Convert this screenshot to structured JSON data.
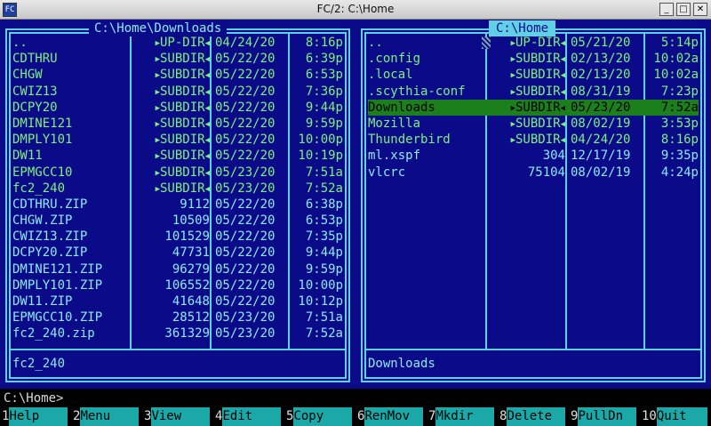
{
  "window": {
    "title": "FC/2: C:\\Home",
    "sys_icon": "FC",
    "buttons": {
      "minimize": "_",
      "maximize": "□",
      "close": "✕"
    }
  },
  "left_panel": {
    "path": "C:\\Home\\Downloads",
    "status": "fc2_240",
    "rows": [
      {
        "name": "..",
        "size": "UP-DIR",
        "date": "04/24/20",
        "time": "8:16p",
        "kind": "dir"
      },
      {
        "name": "CDTHRU",
        "size": "SUBDIR",
        "date": "05/22/20",
        "time": "6:39p",
        "kind": "dir"
      },
      {
        "name": "CHGW",
        "size": "SUBDIR",
        "date": "05/22/20",
        "time": "6:53p",
        "kind": "dir"
      },
      {
        "name": "CWIZ13",
        "size": "SUBDIR",
        "date": "05/22/20",
        "time": "7:36p",
        "kind": "dir"
      },
      {
        "name": "DCPY20",
        "size": "SUBDIR",
        "date": "05/22/20",
        "time": "9:44p",
        "kind": "dir"
      },
      {
        "name": "DMINE121",
        "size": "SUBDIR",
        "date": "05/22/20",
        "time": "9:59p",
        "kind": "dir"
      },
      {
        "name": "DMPLY101",
        "size": "SUBDIR",
        "date": "05/22/20",
        "time": "10:00p",
        "kind": "dir"
      },
      {
        "name": "DW11",
        "size": "SUBDIR",
        "date": "05/22/20",
        "time": "10:19p",
        "kind": "dir"
      },
      {
        "name": "EPMGCC10",
        "size": "SUBDIR",
        "date": "05/23/20",
        "time": "7:51a",
        "kind": "dir"
      },
      {
        "name": "fc2_240",
        "size": "SUBDIR",
        "date": "05/23/20",
        "time": "7:52a",
        "kind": "dir"
      },
      {
        "name": "CDTHRU.ZIP",
        "size": "9112",
        "date": "05/22/20",
        "time": "6:38p",
        "kind": "file"
      },
      {
        "name": "CHGW.ZIP",
        "size": "10509",
        "date": "05/22/20",
        "time": "6:53p",
        "kind": "file"
      },
      {
        "name": "CWIZ13.ZIP",
        "size": "101529",
        "date": "05/22/20",
        "time": "7:35p",
        "kind": "file"
      },
      {
        "name": "DCPY20.ZIP",
        "size": "47731",
        "date": "05/22/20",
        "time": "9:44p",
        "kind": "file"
      },
      {
        "name": "DMINE121.ZIP",
        "size": "96279",
        "date": "05/22/20",
        "time": "9:59p",
        "kind": "file"
      },
      {
        "name": "DMPLY101.ZIP",
        "size": "106552",
        "date": "05/22/20",
        "time": "10:00p",
        "kind": "file"
      },
      {
        "name": "DW11.ZIP",
        "size": "41648",
        "date": "05/22/20",
        "time": "10:12p",
        "kind": "file"
      },
      {
        "name": "EPMGCC10.ZIP",
        "size": "28512",
        "date": "05/23/20",
        "time": "7:51a",
        "kind": "file"
      },
      {
        "name": "fc2_240.zip",
        "size": "361329",
        "date": "05/23/20",
        "time": "7:52a",
        "kind": "file"
      }
    ]
  },
  "right_panel": {
    "path": "C:\\Home",
    "status": "Downloads",
    "rows": [
      {
        "name": "..",
        "size": "UP-DIR",
        "date": "05/21/20",
        "time": "5:14p",
        "kind": "dir",
        "scroll": true
      },
      {
        "name": ".config",
        "size": "SUBDIR",
        "date": "02/13/20",
        "time": "10:02a",
        "kind": "dir"
      },
      {
        "name": ".local",
        "size": "SUBDIR",
        "date": "02/13/20",
        "time": "10:02a",
        "kind": "dir"
      },
      {
        "name": ".scythia-conf",
        "size": "SUBDIR",
        "date": "08/31/19",
        "time": "7:23p",
        "kind": "dir"
      },
      {
        "name": "Downloads",
        "size": "SUBDIR",
        "date": "05/23/20",
        "time": "7:52a",
        "kind": "dir",
        "selected": true
      },
      {
        "name": "Mozilla",
        "size": "SUBDIR",
        "date": "08/02/19",
        "time": "3:53p",
        "kind": "dir"
      },
      {
        "name": "Thunderbird",
        "size": "SUBDIR",
        "date": "04/24/20",
        "time": "8:16p",
        "kind": "dir"
      },
      {
        "name": "ml.xspf",
        "size": "304",
        "date": "12/17/19",
        "time": "9:35p",
        "kind": "file"
      },
      {
        "name": "vlcrc",
        "size": "75104",
        "date": "08/02/19",
        "time": "4:24p",
        "kind": "file"
      }
    ]
  },
  "command_line": "C:\\Home>",
  "fkeys": [
    {
      "num": "1",
      "label": "Help"
    },
    {
      "num": "2",
      "label": "Menu"
    },
    {
      "num": "3",
      "label": "View"
    },
    {
      "num": "4",
      "label": "Edit"
    },
    {
      "num": "5",
      "label": "Copy"
    },
    {
      "num": "6",
      "label": "RenMov"
    },
    {
      "num": "7",
      "label": "Mkdir"
    },
    {
      "num": "8",
      "label": "Delete"
    },
    {
      "num": "9",
      "label": "PullDn"
    },
    {
      "num": "10",
      "label": "Quit"
    }
  ]
}
